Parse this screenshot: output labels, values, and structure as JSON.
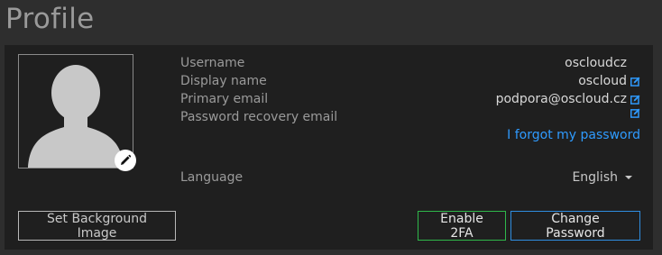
{
  "page": {
    "title": "Profile"
  },
  "profile": {
    "fields": [
      {
        "label": "Username",
        "value": "oscloudcz"
      },
      {
        "label": "Display name",
        "value": "oscloud"
      },
      {
        "label": "Primary email",
        "value": "podpora@oscloud.cz"
      },
      {
        "label": "Password recovery email",
        "value": ""
      }
    ],
    "forgot_password": "I forgot my password",
    "language": {
      "label": "Language",
      "value": "English"
    }
  },
  "buttons": {
    "set_background": "Set Background Image",
    "enable_2fa": "Enable 2FA",
    "change_password": "Change Password"
  },
  "colors": {
    "link": "#2f9bff",
    "enable_2fa_border": "#2fb84a",
    "change_password_border": "#2f8de0"
  },
  "icons": [
    "avatar-silhouette",
    "pencil-icon",
    "edit-icon",
    "caret-down-icon"
  ]
}
